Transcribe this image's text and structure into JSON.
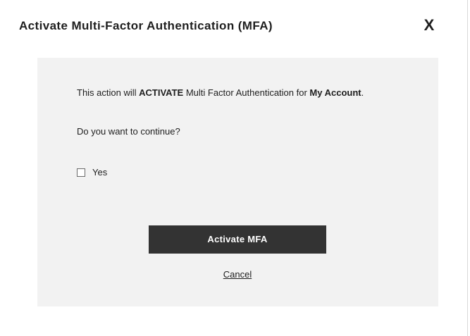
{
  "dialog": {
    "title": "Activate Multi-Factor Authentication (MFA)",
    "close_label": "X"
  },
  "message": {
    "part1": "This action will ",
    "bold1": "ACTIVATE",
    "part2": " Multi Factor Authentication for ",
    "bold2": "My Account",
    "part3": ".",
    "question": "Do you want to continue?"
  },
  "confirm": {
    "checkbox_label": "Yes",
    "checked": false
  },
  "actions": {
    "activate_label": "Activate MFA",
    "cancel_label": "Cancel"
  },
  "colors": {
    "panel_bg": "#f2f2f2",
    "button_bg": "#333333",
    "button_text": "#ffffff"
  }
}
